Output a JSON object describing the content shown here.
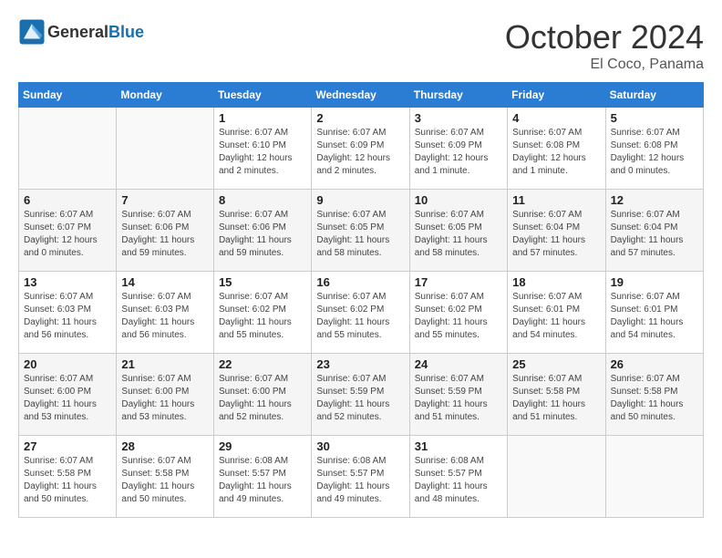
{
  "header": {
    "logo_general": "General",
    "logo_blue": "Blue",
    "month": "October 2024",
    "location": "El Coco, Panama"
  },
  "weekdays": [
    "Sunday",
    "Monday",
    "Tuesday",
    "Wednesday",
    "Thursday",
    "Friday",
    "Saturday"
  ],
  "weeks": [
    [
      {
        "day": "",
        "info": ""
      },
      {
        "day": "",
        "info": ""
      },
      {
        "day": "1",
        "info": "Sunrise: 6:07 AM\nSunset: 6:10 PM\nDaylight: 12 hours\nand 2 minutes."
      },
      {
        "day": "2",
        "info": "Sunrise: 6:07 AM\nSunset: 6:09 PM\nDaylight: 12 hours\nand 2 minutes."
      },
      {
        "day": "3",
        "info": "Sunrise: 6:07 AM\nSunset: 6:09 PM\nDaylight: 12 hours\nand 1 minute."
      },
      {
        "day": "4",
        "info": "Sunrise: 6:07 AM\nSunset: 6:08 PM\nDaylight: 12 hours\nand 1 minute."
      },
      {
        "day": "5",
        "info": "Sunrise: 6:07 AM\nSunset: 6:08 PM\nDaylight: 12 hours\nand 0 minutes."
      }
    ],
    [
      {
        "day": "6",
        "info": "Sunrise: 6:07 AM\nSunset: 6:07 PM\nDaylight: 12 hours\nand 0 minutes."
      },
      {
        "day": "7",
        "info": "Sunrise: 6:07 AM\nSunset: 6:06 PM\nDaylight: 11 hours\nand 59 minutes."
      },
      {
        "day": "8",
        "info": "Sunrise: 6:07 AM\nSunset: 6:06 PM\nDaylight: 11 hours\nand 59 minutes."
      },
      {
        "day": "9",
        "info": "Sunrise: 6:07 AM\nSunset: 6:05 PM\nDaylight: 11 hours\nand 58 minutes."
      },
      {
        "day": "10",
        "info": "Sunrise: 6:07 AM\nSunset: 6:05 PM\nDaylight: 11 hours\nand 58 minutes."
      },
      {
        "day": "11",
        "info": "Sunrise: 6:07 AM\nSunset: 6:04 PM\nDaylight: 11 hours\nand 57 minutes."
      },
      {
        "day": "12",
        "info": "Sunrise: 6:07 AM\nSunset: 6:04 PM\nDaylight: 11 hours\nand 57 minutes."
      }
    ],
    [
      {
        "day": "13",
        "info": "Sunrise: 6:07 AM\nSunset: 6:03 PM\nDaylight: 11 hours\nand 56 minutes."
      },
      {
        "day": "14",
        "info": "Sunrise: 6:07 AM\nSunset: 6:03 PM\nDaylight: 11 hours\nand 56 minutes."
      },
      {
        "day": "15",
        "info": "Sunrise: 6:07 AM\nSunset: 6:02 PM\nDaylight: 11 hours\nand 55 minutes."
      },
      {
        "day": "16",
        "info": "Sunrise: 6:07 AM\nSunset: 6:02 PM\nDaylight: 11 hours\nand 55 minutes."
      },
      {
        "day": "17",
        "info": "Sunrise: 6:07 AM\nSunset: 6:02 PM\nDaylight: 11 hours\nand 55 minutes."
      },
      {
        "day": "18",
        "info": "Sunrise: 6:07 AM\nSunset: 6:01 PM\nDaylight: 11 hours\nand 54 minutes."
      },
      {
        "day": "19",
        "info": "Sunrise: 6:07 AM\nSunset: 6:01 PM\nDaylight: 11 hours\nand 54 minutes."
      }
    ],
    [
      {
        "day": "20",
        "info": "Sunrise: 6:07 AM\nSunset: 6:00 PM\nDaylight: 11 hours\nand 53 minutes."
      },
      {
        "day": "21",
        "info": "Sunrise: 6:07 AM\nSunset: 6:00 PM\nDaylight: 11 hours\nand 53 minutes."
      },
      {
        "day": "22",
        "info": "Sunrise: 6:07 AM\nSunset: 6:00 PM\nDaylight: 11 hours\nand 52 minutes."
      },
      {
        "day": "23",
        "info": "Sunrise: 6:07 AM\nSunset: 5:59 PM\nDaylight: 11 hours\nand 52 minutes."
      },
      {
        "day": "24",
        "info": "Sunrise: 6:07 AM\nSunset: 5:59 PM\nDaylight: 11 hours\nand 51 minutes."
      },
      {
        "day": "25",
        "info": "Sunrise: 6:07 AM\nSunset: 5:58 PM\nDaylight: 11 hours\nand 51 minutes."
      },
      {
        "day": "26",
        "info": "Sunrise: 6:07 AM\nSunset: 5:58 PM\nDaylight: 11 hours\nand 50 minutes."
      }
    ],
    [
      {
        "day": "27",
        "info": "Sunrise: 6:07 AM\nSunset: 5:58 PM\nDaylight: 11 hours\nand 50 minutes."
      },
      {
        "day": "28",
        "info": "Sunrise: 6:07 AM\nSunset: 5:58 PM\nDaylight: 11 hours\nand 50 minutes."
      },
      {
        "day": "29",
        "info": "Sunrise: 6:08 AM\nSunset: 5:57 PM\nDaylight: 11 hours\nand 49 minutes."
      },
      {
        "day": "30",
        "info": "Sunrise: 6:08 AM\nSunset: 5:57 PM\nDaylight: 11 hours\nand 49 minutes."
      },
      {
        "day": "31",
        "info": "Sunrise: 6:08 AM\nSunset: 5:57 PM\nDaylight: 11 hours\nand 48 minutes."
      },
      {
        "day": "",
        "info": ""
      },
      {
        "day": "",
        "info": ""
      }
    ]
  ]
}
